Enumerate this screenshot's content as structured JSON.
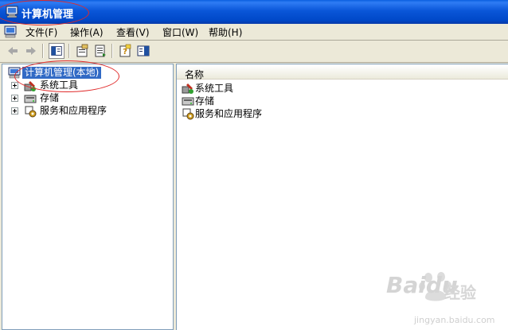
{
  "window": {
    "title": "计算机管理"
  },
  "menu": [
    {
      "label": "文件(F)"
    },
    {
      "label": "操作(A)"
    },
    {
      "label": "查看(V)"
    },
    {
      "label": "窗口(W)"
    },
    {
      "label": "帮助(H)"
    }
  ],
  "toolbar": {
    "buttons": [
      "back-arrow-icon",
      "forward-arrow-icon",
      "show-hide-tree-icon",
      "properties-icon",
      "export-list-icon",
      "help-icon",
      "show-hide-action-pane-icon"
    ]
  },
  "tree": {
    "root": "计算机管理(本地)",
    "children": [
      "系统工具",
      "存储",
      "服务和应用程序"
    ]
  },
  "list": {
    "column": "名称",
    "items": [
      "系统工具",
      "存储",
      "服务和应用程序"
    ]
  },
  "watermark": {
    "brand": "Baidu",
    "cn": "经验",
    "url": "jingyan.baidu.com"
  },
  "colors": {
    "titlebar": "#0a56d8",
    "selection": "#316ac5",
    "annotation": "#e02a2a"
  }
}
